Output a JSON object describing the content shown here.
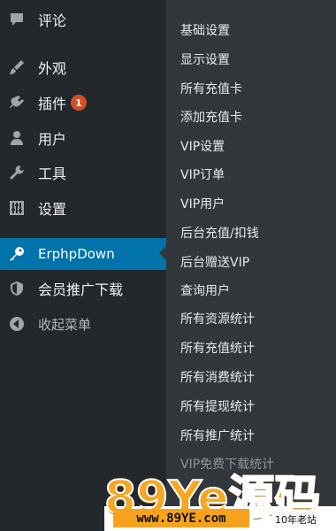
{
  "sidebar": {
    "items": [
      {
        "label": "评论"
      },
      {
        "label": "外观"
      },
      {
        "label": "插件",
        "badge": "1"
      },
      {
        "label": "用户"
      },
      {
        "label": "工具"
      },
      {
        "label": "设置"
      },
      {
        "label": "ErphpDown"
      },
      {
        "label": "会员推广下载"
      },
      {
        "label": "收起菜单"
      }
    ]
  },
  "submenu": {
    "items": [
      "基础设置",
      "显示设置",
      "所有充值卡",
      "添加充值卡",
      "VIP设置",
      "VIP订单",
      "VIP用户",
      "后台充值/扣钱",
      "后台赠送VIP",
      "查询用户",
      "所有资源统计",
      "所有充值统计",
      "所有消费统计",
      "所有提现统计",
      "所有推广统计",
      "VIP免费下载统计"
    ]
  },
  "watermark": {
    "brand": "89Ye源码",
    "url": "www.89YE.com",
    "tag": "10年老站"
  },
  "colors": {
    "menu_bg": "#23282d",
    "submenu_bg": "#32373c",
    "active": "#0073aa",
    "badge": "#d54e21"
  }
}
